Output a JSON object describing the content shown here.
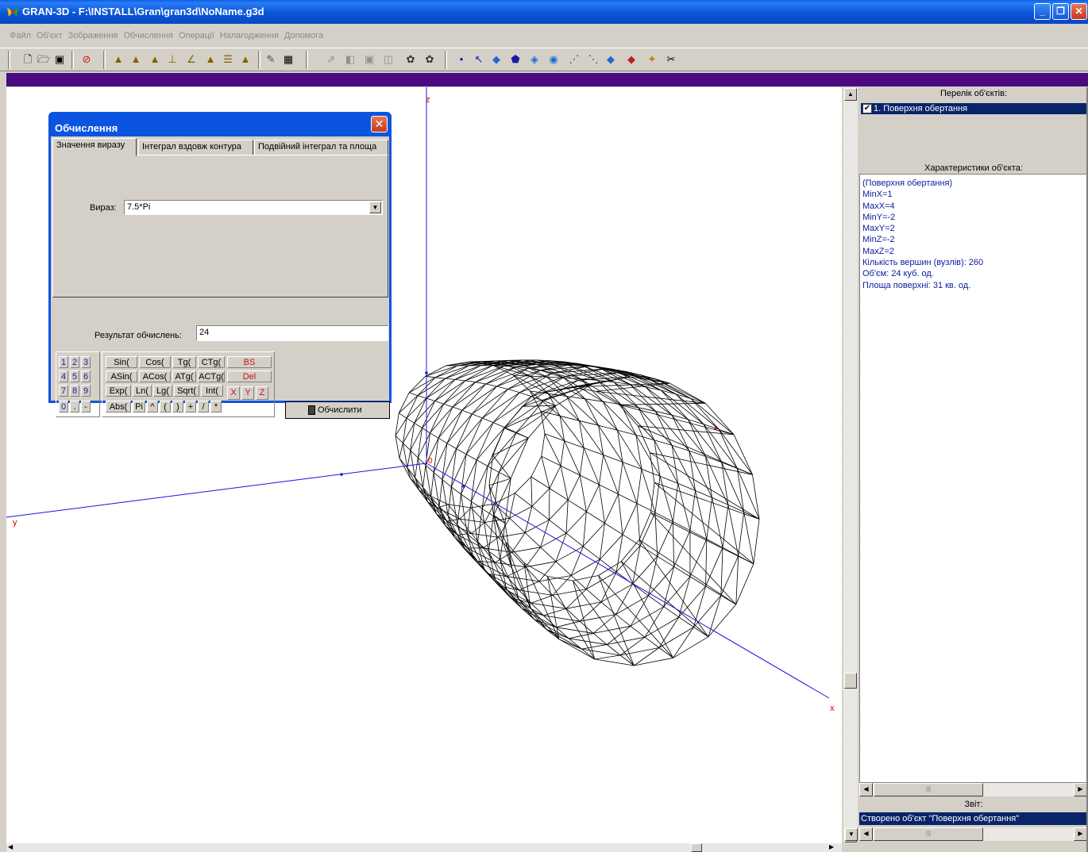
{
  "window": {
    "title": "GRAN-3D - F:\\INSTALL\\Gran\\gran3d\\NoName.g3d"
  },
  "menu": [
    "Файл",
    "Об'єкт",
    "Зображення",
    "Обчислення",
    "Операції",
    "Налагодження",
    "Допомога"
  ],
  "toolbar": {
    "file_icons": [
      "new-icon",
      "open-icon",
      "save-icon",
      "exit-icon"
    ],
    "create_icons": [
      "surface-icon",
      "solid-icon",
      "graph-icon",
      "plane-icon",
      "line-icon",
      "cone-icon",
      "cylinder-icon",
      "pyramid-icon",
      "wizard-icon",
      "calculator-icon"
    ],
    "edit_icons": [
      "move-icon",
      "cube-icon",
      "frame-icon",
      "box-icon",
      "palette-icon",
      "render-icon"
    ],
    "ops_icons": [
      "point-icon",
      "segment-icon",
      "polygon-icon",
      "prism-icon",
      "rotate-icon",
      "revolve-icon",
      "section-icon",
      "transform-icon",
      "surface-op-icon",
      "mix-icon",
      "paint-icon",
      "cut-icon"
    ]
  },
  "viewport": {
    "axis_labels": {
      "x": "x",
      "y": "y",
      "z": "z",
      "origin": "0"
    },
    "colors": {
      "axis": "#1515e6",
      "label": "#e60000",
      "mesh": "#000000"
    }
  },
  "objects_panel": {
    "title": "Перелік об'єктів:",
    "items": [
      {
        "label": "1. Поверхня обертання",
        "checked": true
      }
    ]
  },
  "properties_panel": {
    "title": "Характеристики об'єкта:",
    "lines": [
      "(Поверхня обертання)",
      "MinX=1",
      "MaxX=4",
      "MinY=-2",
      "MaxY=2",
      "MinZ=-2",
      "MaxZ=2",
      "Кількість вершин (вузлів): 260",
      "Об'єм: 24 куб. од.",
      "Площа поверхні: 31 кв. од."
    ]
  },
  "report_panel": {
    "title": "Звіт:",
    "message": "Створено об'єкт \"Поверхня обертання\""
  },
  "dialog": {
    "title": "Обчислення",
    "tabs": [
      "Значення виразу",
      "Інтеграл вздовж контура",
      "Подвійний інтеграл та площа"
    ],
    "active_tab": 0,
    "expression_label": "Вираз:",
    "expression_value": "7.5*Pi",
    "result_label": "Результат обчислень:",
    "result_value": "24",
    "keypad": {
      "digits": [
        [
          "1",
          "2",
          "3"
        ],
        [
          "4",
          "5",
          "6"
        ],
        [
          "7",
          "8",
          "9"
        ],
        [
          "0",
          ".",
          "-"
        ]
      ],
      "functions": [
        [
          "Sin(",
          "Cos(",
          "Tg(",
          "CTg("
        ],
        [
          "ASin(",
          "ACos(",
          "ATg(",
          "ACTg("
        ],
        [
          "Exp(",
          "Ln(",
          "Lg(",
          "Sqrt(",
          "Int("
        ],
        [
          "Abs(",
          "Pi",
          "^",
          "(",
          ")",
          "+",
          "/",
          "*"
        ]
      ],
      "edit": [
        "BS",
        "Del"
      ],
      "vars": [
        "X",
        "Y",
        "Z"
      ]
    },
    "compute_button": "Обчислити"
  }
}
